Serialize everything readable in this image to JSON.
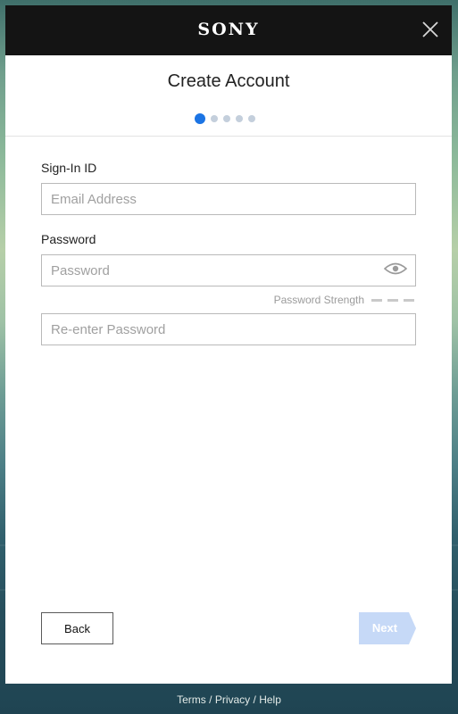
{
  "header": {
    "brand": "SONY",
    "title": "Create Account"
  },
  "steps": {
    "total": 5,
    "current": 1
  },
  "form": {
    "signin_label": "Sign-In ID",
    "email_placeholder": "Email Address",
    "password_label": "Password",
    "password_placeholder": "Password",
    "strength_label": "Password Strength",
    "reenter_placeholder": "Re-enter Password"
  },
  "actions": {
    "back_label": "Back",
    "next_label": "Next"
  },
  "footer": {
    "terms": "Terms",
    "separator": "/",
    "privacy": "Privacy",
    "help": "Help"
  },
  "colors": {
    "accent": "#1b74e4",
    "next_disabled": "#c6d9f7",
    "topbar": "#141414"
  },
  "icons": {
    "close": "close-icon",
    "eye": "eye-icon"
  }
}
